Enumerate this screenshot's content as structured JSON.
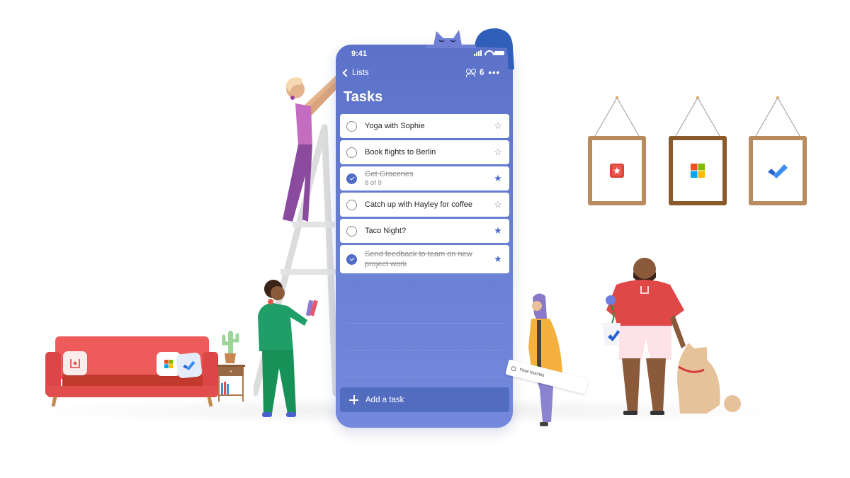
{
  "phone": {
    "status_time": "9:41",
    "back_label": "Lists",
    "members_count": "6",
    "more_label": "•••",
    "list_title": "Tasks",
    "tasks": [
      {
        "title": "Yoga with Sophie",
        "subtitle": "",
        "completed": false,
        "important": false
      },
      {
        "title": "Book flights to Berlin",
        "subtitle": "",
        "completed": false,
        "important": false
      },
      {
        "title": "Get Groceries",
        "subtitle": "8 of 9",
        "completed": true,
        "important": true
      },
      {
        "title": "Catch up with Hayley for coffee",
        "subtitle": "",
        "completed": false,
        "important": false
      },
      {
        "title": "Taco Night?",
        "subtitle": "",
        "completed": false,
        "important": true
      },
      {
        "title": "Send feedback to team on new project work",
        "subtitle": "",
        "completed": true,
        "important": true
      }
    ],
    "add_task_label": "Add a task",
    "accent_color": "#4f6bc7",
    "background_color": "#5c72c9"
  },
  "illustration": {
    "floating_note": "Final touches",
    "frames": [
      {
        "icon": "wunderlist-icon",
        "frame_color": "#b98c5f"
      },
      {
        "icon": "microsoft-logo-icon",
        "frame_color": "#8b5a2b"
      },
      {
        "icon": "todo-check-icon",
        "frame_color": "#b98c5f"
      }
    ],
    "sofa_color": "#ee5b5b"
  },
  "icons": {
    "star_outline": "☆",
    "star_filled": "★"
  }
}
